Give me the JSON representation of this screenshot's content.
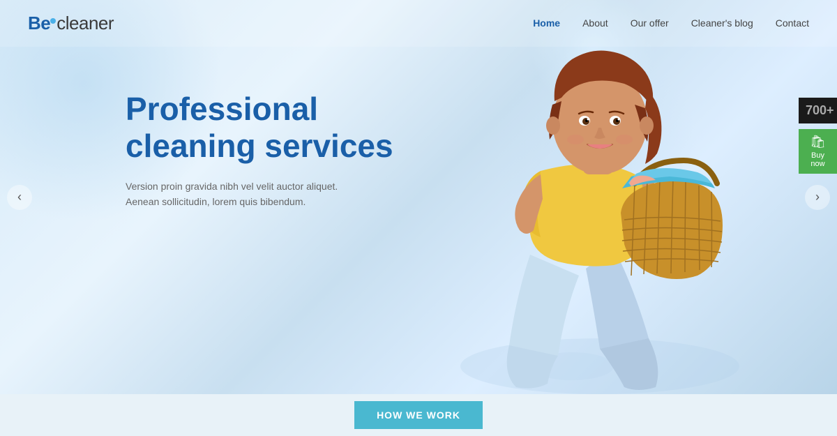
{
  "logo": {
    "be": "Be",
    "cleaner": "cleaner"
  },
  "nav": {
    "items": [
      {
        "label": "Home",
        "active": true
      },
      {
        "label": "About",
        "active": false
      },
      {
        "label": "Our offer",
        "active": false
      },
      {
        "label": "Cleaner's blog",
        "active": false
      },
      {
        "label": "Contact",
        "active": false
      }
    ]
  },
  "hero": {
    "title": "Professional\ncleaning services",
    "subtitle": "Version proin gravida nibh vel velit auctor aliquet.\nAenean sollicitudin, lorem quis bibendum.",
    "arrow_left": "‹",
    "arrow_right": "›"
  },
  "sidebar": {
    "counter_label": "700+",
    "buy_icon": "🛍",
    "buy_label": "Buy now"
  },
  "bottom": {
    "how_we_work": "HOW WE WORK"
  }
}
